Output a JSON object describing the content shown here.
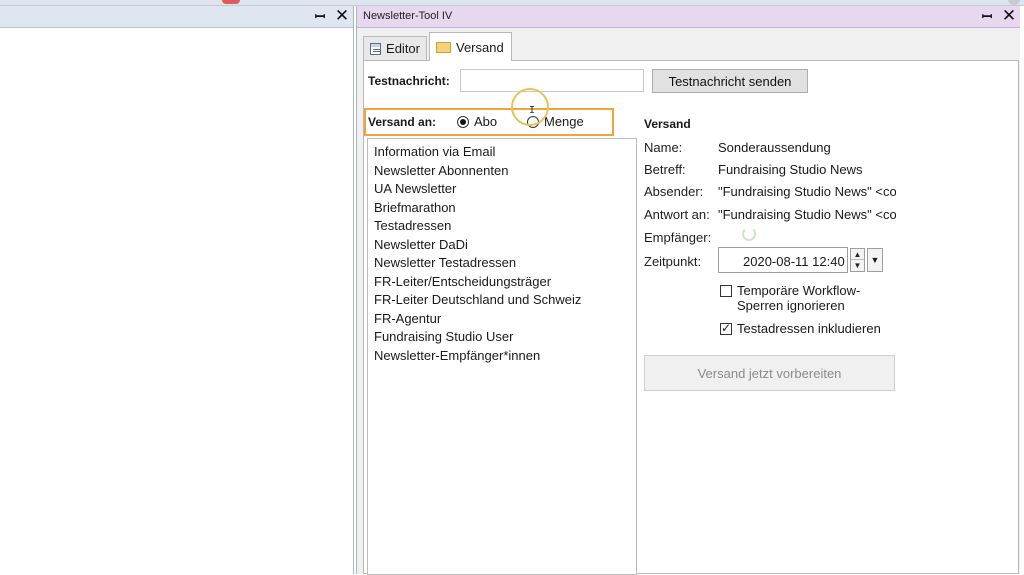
{
  "left_panel": {
    "pin_icon": "pin-icon",
    "close_icon": "close-icon"
  },
  "tool_window": {
    "title": "Newsletter-Tool IV",
    "tabs": [
      {
        "label": "Editor",
        "icon": "editor-icon",
        "active": false
      },
      {
        "label": "Versand",
        "icon": "envelope-icon",
        "active": true
      }
    ]
  },
  "test_message": {
    "label": "Testnachricht:",
    "value": "",
    "send_button": "Testnachricht senden"
  },
  "versand_an": {
    "label": "Versand an:",
    "options": [
      {
        "label": "Abo",
        "checked": true
      },
      {
        "label": "Menge",
        "checked": false
      }
    ]
  },
  "recipients_list": [
    "Information via Email",
    "Newsletter Abonnenten",
    "UA Newsletter",
    "Briefmarathon",
    "Testadressen",
    "Newsletter DaDi",
    "Newsletter Testadressen",
    "FR-Leiter/Entscheidungsträger",
    "FR-Leiter Deutschland und Schweiz",
    "FR-Agentur",
    "Fundraising Studio User",
    "Newsletter-Empfänger*innen"
  ],
  "details": {
    "title": "Versand",
    "name_label": "Name:",
    "name_value": "Sonderaussendung",
    "betreff_label": "Betreff:",
    "betreff_value": "Fundraising Studio News",
    "absender_label": "Absender:",
    "absender_value": "\"Fundraising Studio News\" <co",
    "antwort_label": "Antwort an:",
    "antwort_value": "\"Fundraising Studio News\" <co",
    "empfaenger_label": "Empfänger:",
    "zeitpunkt_label": "Zeitpunkt:",
    "zeitpunkt_value": "2020-08-11 12:40",
    "check_workflow": {
      "label": "Temporäre Workflow-Sperren ignorieren",
      "line1": "Temporäre Workflow-",
      "line2": "Sperren ignorieren",
      "checked": false
    },
    "check_testadressen": {
      "label": "Testadressen inkludieren",
      "checked": true
    },
    "prepare_button": "Versand jetzt vorbereiten"
  },
  "colors": {
    "tool_title_bg": "#e7d7ef",
    "left_title_bg": "#dfe6f1",
    "highlight_border": "#f0a53a"
  }
}
